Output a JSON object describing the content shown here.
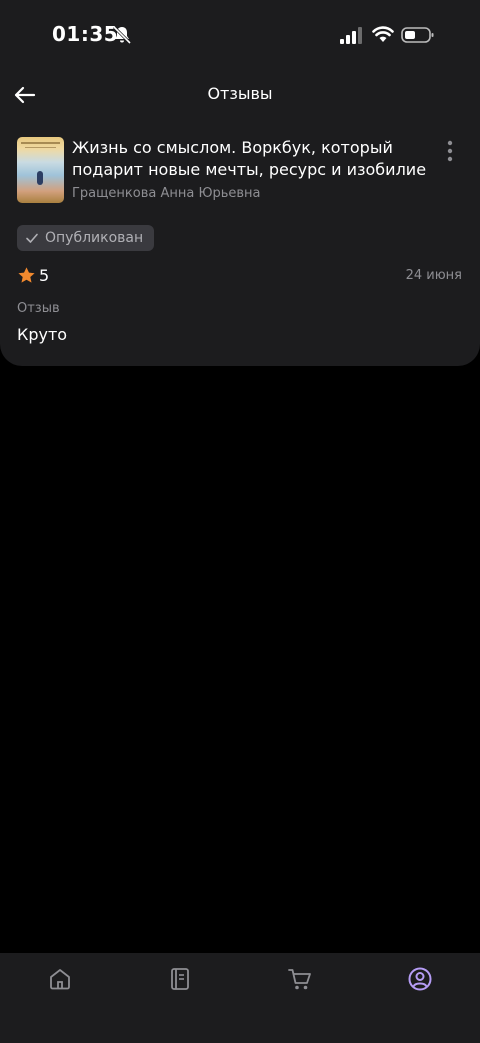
{
  "status_bar": {
    "time": "01:35"
  },
  "header": {
    "title": "Отзывы"
  },
  "book": {
    "title": "Жизнь со смыслом. Воркбук, который подарит новые мечты, ресурс и изобилие",
    "author": "Гращенкова Анна Юрьевна"
  },
  "review": {
    "status": "Опубликован",
    "rating": "5",
    "date": "24 июня",
    "label": "Отзыв",
    "text": "Круто"
  },
  "colors": {
    "star": "#f2892e",
    "active_nav": "#b59cf5",
    "panel": "#1c1c1e"
  },
  "nav": [
    {
      "icon": "home-icon",
      "active": false
    },
    {
      "icon": "book-icon",
      "active": false
    },
    {
      "icon": "cart-icon",
      "active": false
    },
    {
      "icon": "profile-icon",
      "active": true
    }
  ]
}
